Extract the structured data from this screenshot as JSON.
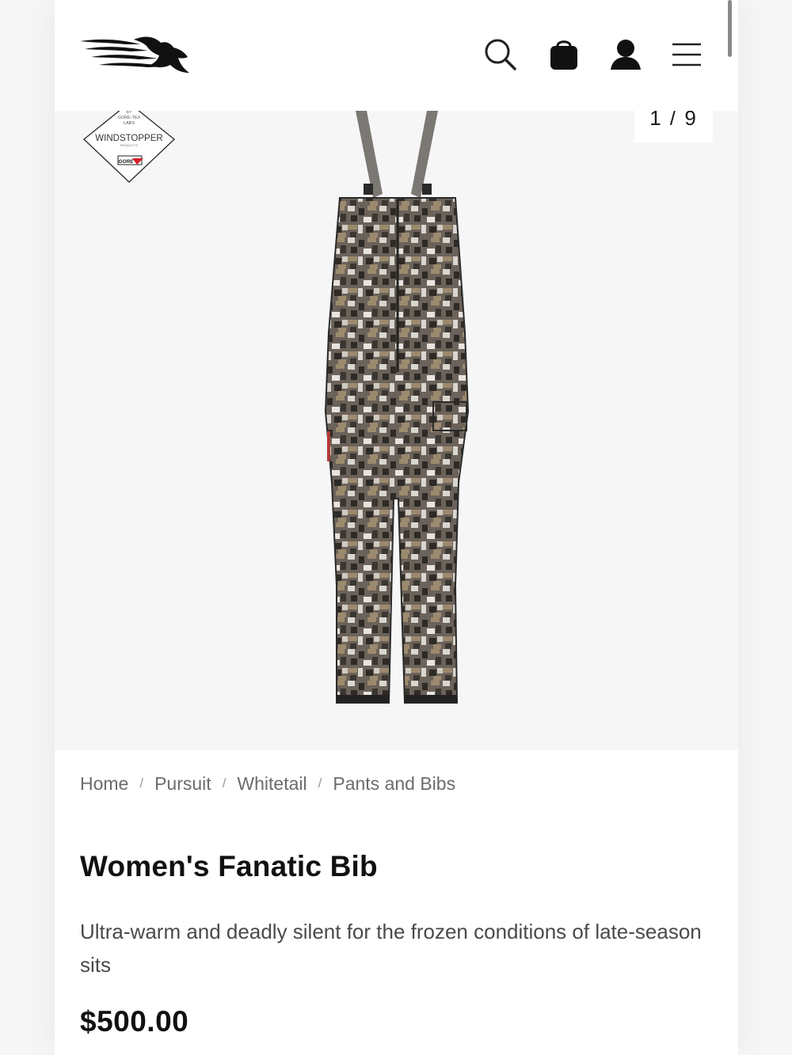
{
  "header": {
    "logo_name": "sitka-logo",
    "icons": [
      "search-icon",
      "shopping-bag-icon",
      "account-icon",
      "menu-icon"
    ]
  },
  "gallery": {
    "counter": "1 / 9",
    "badge": {
      "line1": "BY",
      "line2": "GORE-TEX",
      "line3": "LABS",
      "brand": "WINDSTOPPER",
      "sub": "PRODUCTS",
      "gore": "GORE"
    }
  },
  "breadcrumb": [
    {
      "label": "Home"
    },
    {
      "label": "Pursuit"
    },
    {
      "label": "Whitetail"
    },
    {
      "label": "Pants and Bibs"
    }
  ],
  "breadcrumb_separator": "/",
  "product": {
    "title": "Women's Fanatic Bib",
    "description": "Ultra-warm and deadly silent for the frozen conditions of late-season sits",
    "price": "$500.00"
  },
  "colors": {
    "page_bg": "#f6f6f6",
    "text": "#111111",
    "muted": "#6c6c6c",
    "camo_dark": "#2e2a26",
    "camo_light": "#d9d6d0",
    "camo_tan": "#9c8a6e"
  }
}
